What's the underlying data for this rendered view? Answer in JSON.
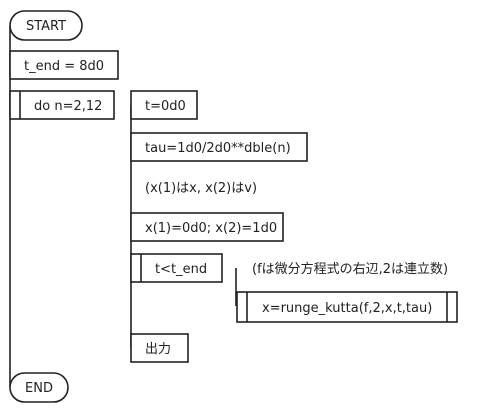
{
  "flowchart": {
    "start": "START",
    "end": "END",
    "t_end": "t_end = 8d0",
    "outer_loop": "do n=2,12",
    "t_init": "t=0d0",
    "tau": "tau=1d0/2d0**dble(n)",
    "comment_vars": "(x(1)はx, x(2)はv)",
    "init_x": "x(1)=0d0; x(2)=1d0",
    "inner_loop": "t<t_end",
    "comment_f": "(fは微分方程式の右辺,2は連立数)",
    "rk_call": "x=runge_kutta(f,2,x,t,tau)",
    "output": "出力"
  }
}
